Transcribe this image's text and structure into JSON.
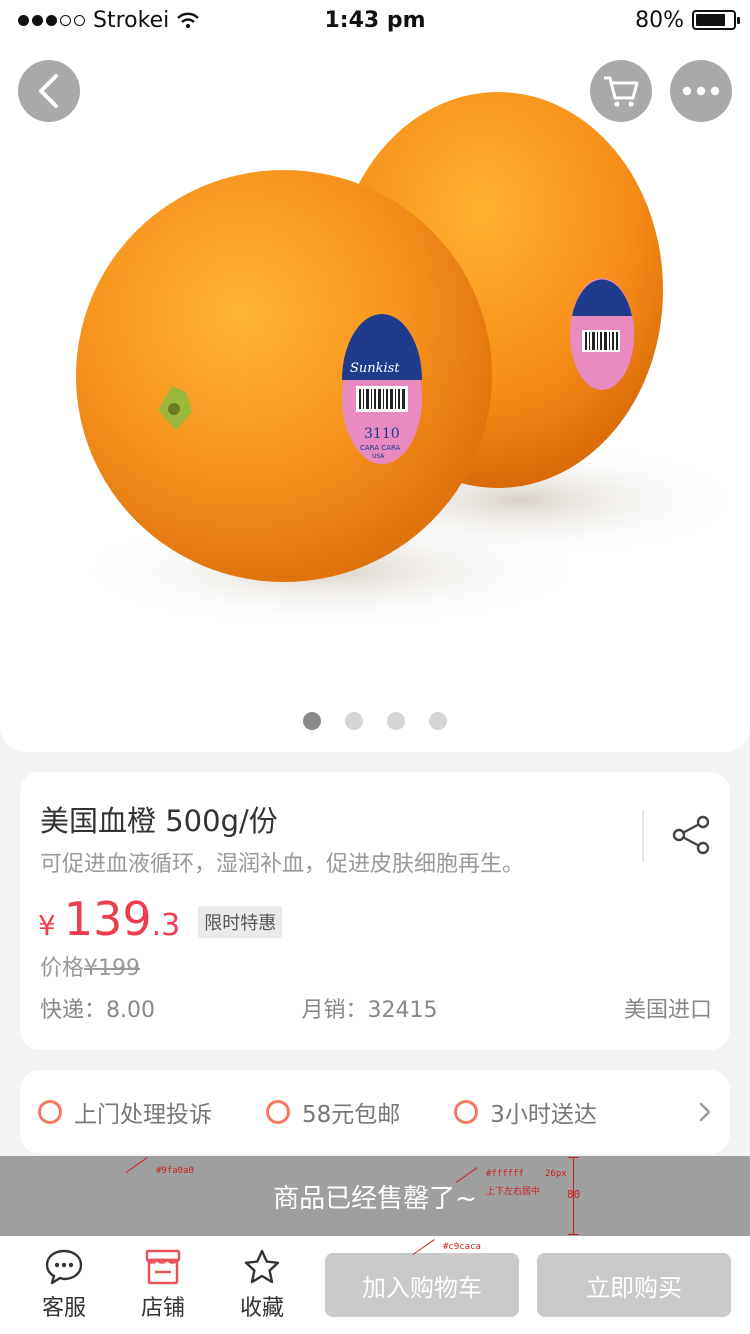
{
  "status_bar": {
    "carrier": "Strokei",
    "time": "1:43 pm",
    "battery": "80%",
    "battery_level": 0.8
  },
  "gallery": {
    "slide_count": 4,
    "active_index": 0
  },
  "top_actions": {
    "back_icon": "chevron-left-icon",
    "cart_icon": "cart-icon",
    "more_icon": "more-dots-icon"
  },
  "product": {
    "title": "美国血橙 500g/份",
    "subtitle": "可促进血液循环，湿润补血，促进皮肤细胞再生。",
    "price_symbol": "¥",
    "price_int": "139",
    "price_dec": ".3",
    "promo_badge": "限时特惠",
    "orig_price_label": "价格",
    "orig_price_value": "¥199",
    "shipping": "快递：8.00",
    "monthly_sales": "月销：32415",
    "origin": "美国进口"
  },
  "services": {
    "items": [
      "上门处理投诉",
      "58元包邮",
      "3小时送达"
    ]
  },
  "soldout": {
    "message": "商品已经售罄了~",
    "annot_bg": "#9fa0a0",
    "annot_color": "#ffffff",
    "annot_size": "26px",
    "annot_align": "上下左右居中",
    "annot_height": "80",
    "annot_btn": "#c9caca"
  },
  "bottom_bar": {
    "service_label": "客服",
    "shop_label": "店铺",
    "fav_label": "收藏",
    "add_cart_label": "加入购物车",
    "buy_now_label": "立即购买"
  },
  "colors": {
    "price": "#ee3d4d",
    "accent_ring": "#f4795a",
    "shop_icon": "#e9515b",
    "disabled_btn": "#c9caca",
    "soldout_bg": "#9fa0a0"
  }
}
